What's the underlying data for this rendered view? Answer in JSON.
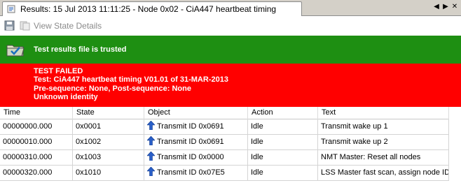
{
  "tab": {
    "title": "Results: 15 Jul 2013 11:11:25 - Node 0x02 - CiA447 heartbeat timing",
    "icon": "results-doc-icon",
    "nav_prev": "◀",
    "nav_next": "▶",
    "close": "✕"
  },
  "toolbar": {
    "save_icon": "save-icon",
    "view_state_details_label": "View State Details",
    "view_state_details_enabled": false
  },
  "banners": {
    "trusted": {
      "text": "Test results file is trusted",
      "color": "#1e8f12",
      "icon": "folder-check-icon"
    },
    "result": {
      "color": "#ff0000",
      "lines": [
        "TEST FAILED",
        "Test: CiA447 heartbeat timing V01.01 of 31-MAR-2013",
        "Pre-sequence: None, Post-sequence: None",
        "Unknown identity"
      ]
    }
  },
  "table": {
    "columns": [
      "Time",
      "State",
      "Object",
      "Action",
      "Text"
    ],
    "rows": [
      {
        "time": "00000000.000",
        "state": "0x0001",
        "object": "Transmit ID 0x0691",
        "action": "Idle",
        "text": "Transmit wake up 1"
      },
      {
        "time": "00000010.000",
        "state": "0x1002",
        "object": "Transmit ID 0x0691",
        "action": "Idle",
        "text": "Transmit wake up 2"
      },
      {
        "time": "00000310.000",
        "state": "0x1003",
        "object": "Transmit ID 0x0000",
        "action": "Idle",
        "text": "NMT Master: Reset all nodes"
      },
      {
        "time": "00000320.000",
        "state": "0x1010",
        "object": "Transmit ID 0x07E5",
        "action": "Idle",
        "text": "LSS Master fast scan, assign node ID"
      }
    ],
    "object_icon": "blue-up-arrow-icon"
  }
}
